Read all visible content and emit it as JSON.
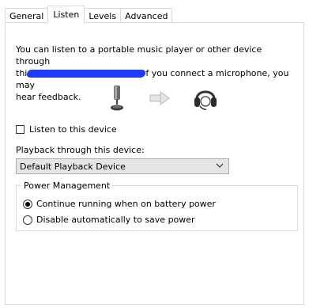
{
  "tabs": [
    {
      "label": "General",
      "active": false
    },
    {
      "label": "Listen",
      "active": true
    },
    {
      "label": "Levels",
      "active": false
    },
    {
      "label": "Advanced",
      "active": false
    }
  ],
  "listen": {
    "description_line1": "You can listen to a portable music player or other device through",
    "description_line2_prefix": "thi",
    "description_line2_suffix": "f you connect a microphone, you may",
    "description_line3": "hear feedback.",
    "listen_checkbox_label": "Listen to this device",
    "listen_checked": false,
    "playback_label": "Playback through this device:",
    "playback_selected": "Default Playback Device"
  },
  "power": {
    "title": "Power Management",
    "option1": "Continue running when on battery power",
    "option2": "Disable automatically to save power",
    "selected": "option1"
  },
  "icons": {
    "source": "microphone-icon",
    "arrow": "arrow-right-icon",
    "destination": "headset-icon"
  },
  "colors": {
    "redaction": "#1a3cff",
    "border": "#d9d9d9",
    "select_bg": "#e5e5e5"
  }
}
